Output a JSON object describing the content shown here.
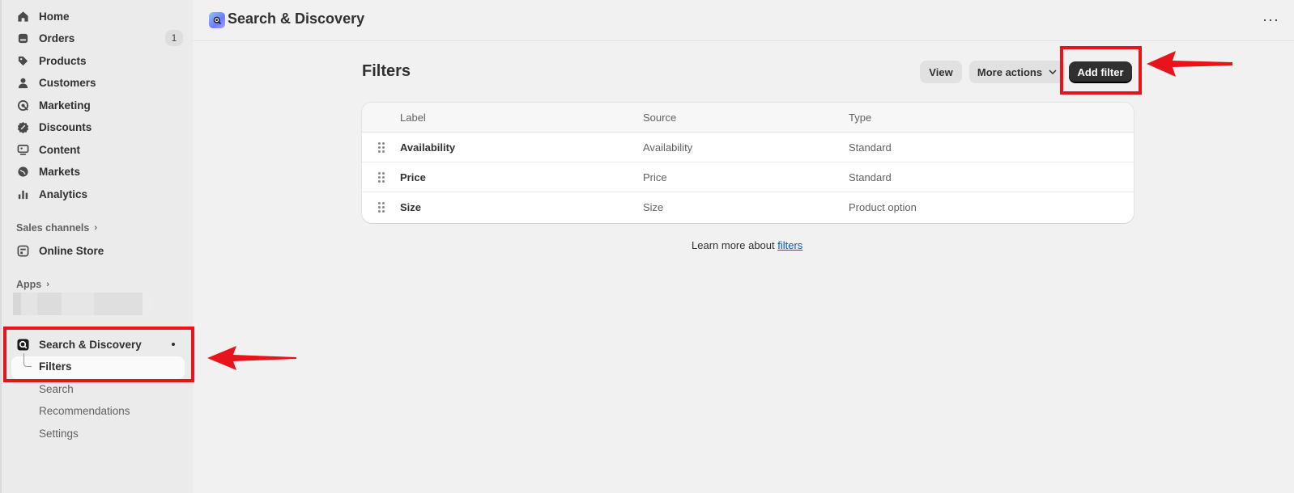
{
  "sidebar": {
    "items": [
      {
        "label": "Home",
        "icon": "home-icon"
      },
      {
        "label": "Orders",
        "icon": "orders-icon",
        "badge": "1"
      },
      {
        "label": "Products",
        "icon": "tag-icon"
      },
      {
        "label": "Customers",
        "icon": "person-icon"
      },
      {
        "label": "Marketing",
        "icon": "marketing-icon"
      },
      {
        "label": "Discounts",
        "icon": "discount-icon"
      },
      {
        "label": "Content",
        "icon": "content-icon"
      },
      {
        "label": "Markets",
        "icon": "globe-icon"
      },
      {
        "label": "Analytics",
        "icon": "chart-icon"
      }
    ],
    "sales_channels_label": "Sales channels",
    "online_store_label": "Online Store",
    "apps_label": "Apps",
    "app": {
      "label": "Search & Discovery",
      "subitems": [
        "Filters",
        "Search",
        "Recommendations",
        "Settings"
      ],
      "active_subitem": "Filters"
    }
  },
  "header": {
    "title": "Search & Discovery",
    "more_label": "···"
  },
  "main": {
    "title": "Filters",
    "actions": {
      "view": "View",
      "more_actions": "More actions",
      "add_filter": "Add filter"
    },
    "table": {
      "columns": [
        "Label",
        "Source",
        "Type"
      ],
      "rows": [
        {
          "label": "Availability",
          "source": "Availability",
          "type": "Standard"
        },
        {
          "label": "Price",
          "source": "Price",
          "type": "Standard"
        },
        {
          "label": "Size",
          "source": "Size",
          "type": "Product option"
        }
      ]
    },
    "learn_more": {
      "prefix": "Learn more about",
      "link": "filters"
    }
  },
  "colors": {
    "annotation": "#e8141c",
    "primary_button": "#303030",
    "link": "#005bd3"
  }
}
